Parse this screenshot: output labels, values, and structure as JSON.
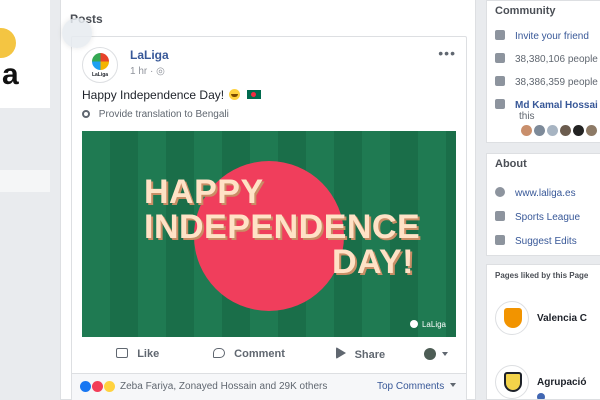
{
  "posts": {
    "section_title": "Posts",
    "post": {
      "page_name": "LaLiga",
      "page_logo_label": "LaLiga",
      "time": "1 hr",
      "text": "Happy Independence Day!",
      "translate_label": "Provide translation to Bengali",
      "image": {
        "line1": "HAPPY",
        "line2": "INDEPENDENCE",
        "line3": "DAY!",
        "watermark": "LaLiga"
      },
      "actions": {
        "like": "Like",
        "comment": "Comment",
        "share": "Share"
      },
      "reactions_text": "Zeba Fariya, Zonayed Hossain and 29K others",
      "top_comments": "Top Comments"
    }
  },
  "community": {
    "title": "Community",
    "items": [
      "Invite your friend",
      "38,380,106 people",
      "38,386,359 people",
      "Md Kamal Hossai"
    ],
    "friend_suffix": "this"
  },
  "about": {
    "title": "About",
    "items": [
      "www.laliga.es",
      "Sports League",
      "Suggest Edits"
    ]
  },
  "pages_liked": {
    "title": "Pages liked by this Page",
    "items": [
      "Valencia C",
      "Agrupació"
    ]
  },
  "left_card": {
    "letter": "a"
  }
}
